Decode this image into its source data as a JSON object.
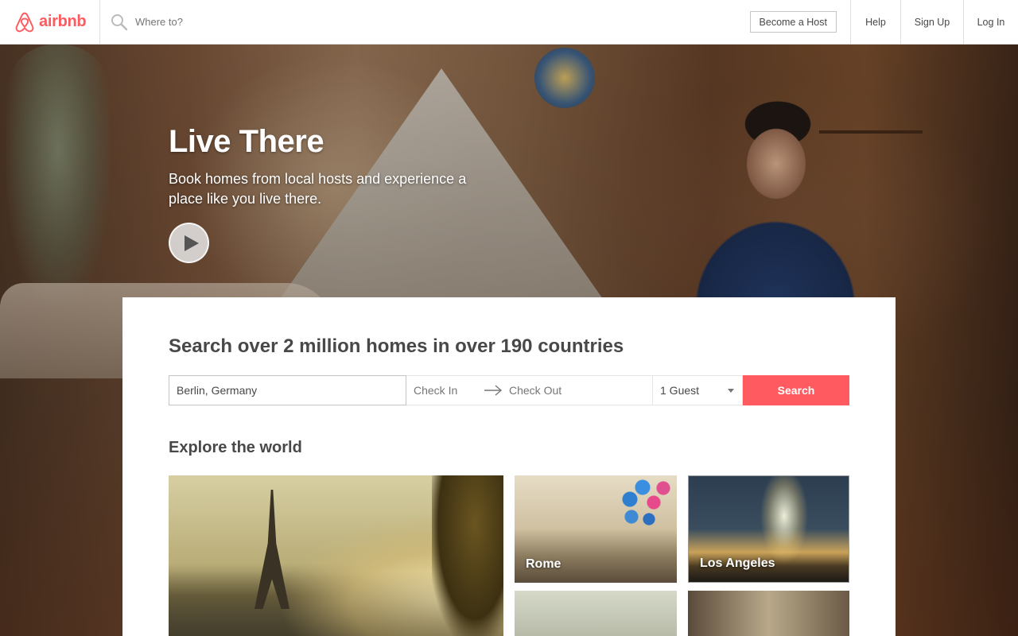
{
  "brand": {
    "name": "airbnb",
    "color": "#ff5a5f"
  },
  "header": {
    "search_placeholder": "Where to?",
    "become_host_label": "Become a Host",
    "help_label": "Help",
    "signup_label": "Sign Up",
    "login_label": "Log In"
  },
  "hero": {
    "title": "Live There",
    "subtitle": "Book homes from local hosts and experience a place like you live there.",
    "play_icon": "play-icon"
  },
  "search_panel": {
    "title": "Search over 2 million homes in over 190 countries",
    "location_value": "Berlin, Germany",
    "check_in_placeholder": "Check In",
    "check_out_placeholder": "Check Out",
    "guests_value": "1 Guest",
    "search_label": "Search"
  },
  "explore": {
    "title": "Explore the world",
    "destinations": [
      {
        "label": ""
      },
      {
        "label": "Rome"
      },
      {
        "label": "Los Angeles"
      },
      {
        "label": ""
      },
      {
        "label": ""
      }
    ]
  }
}
